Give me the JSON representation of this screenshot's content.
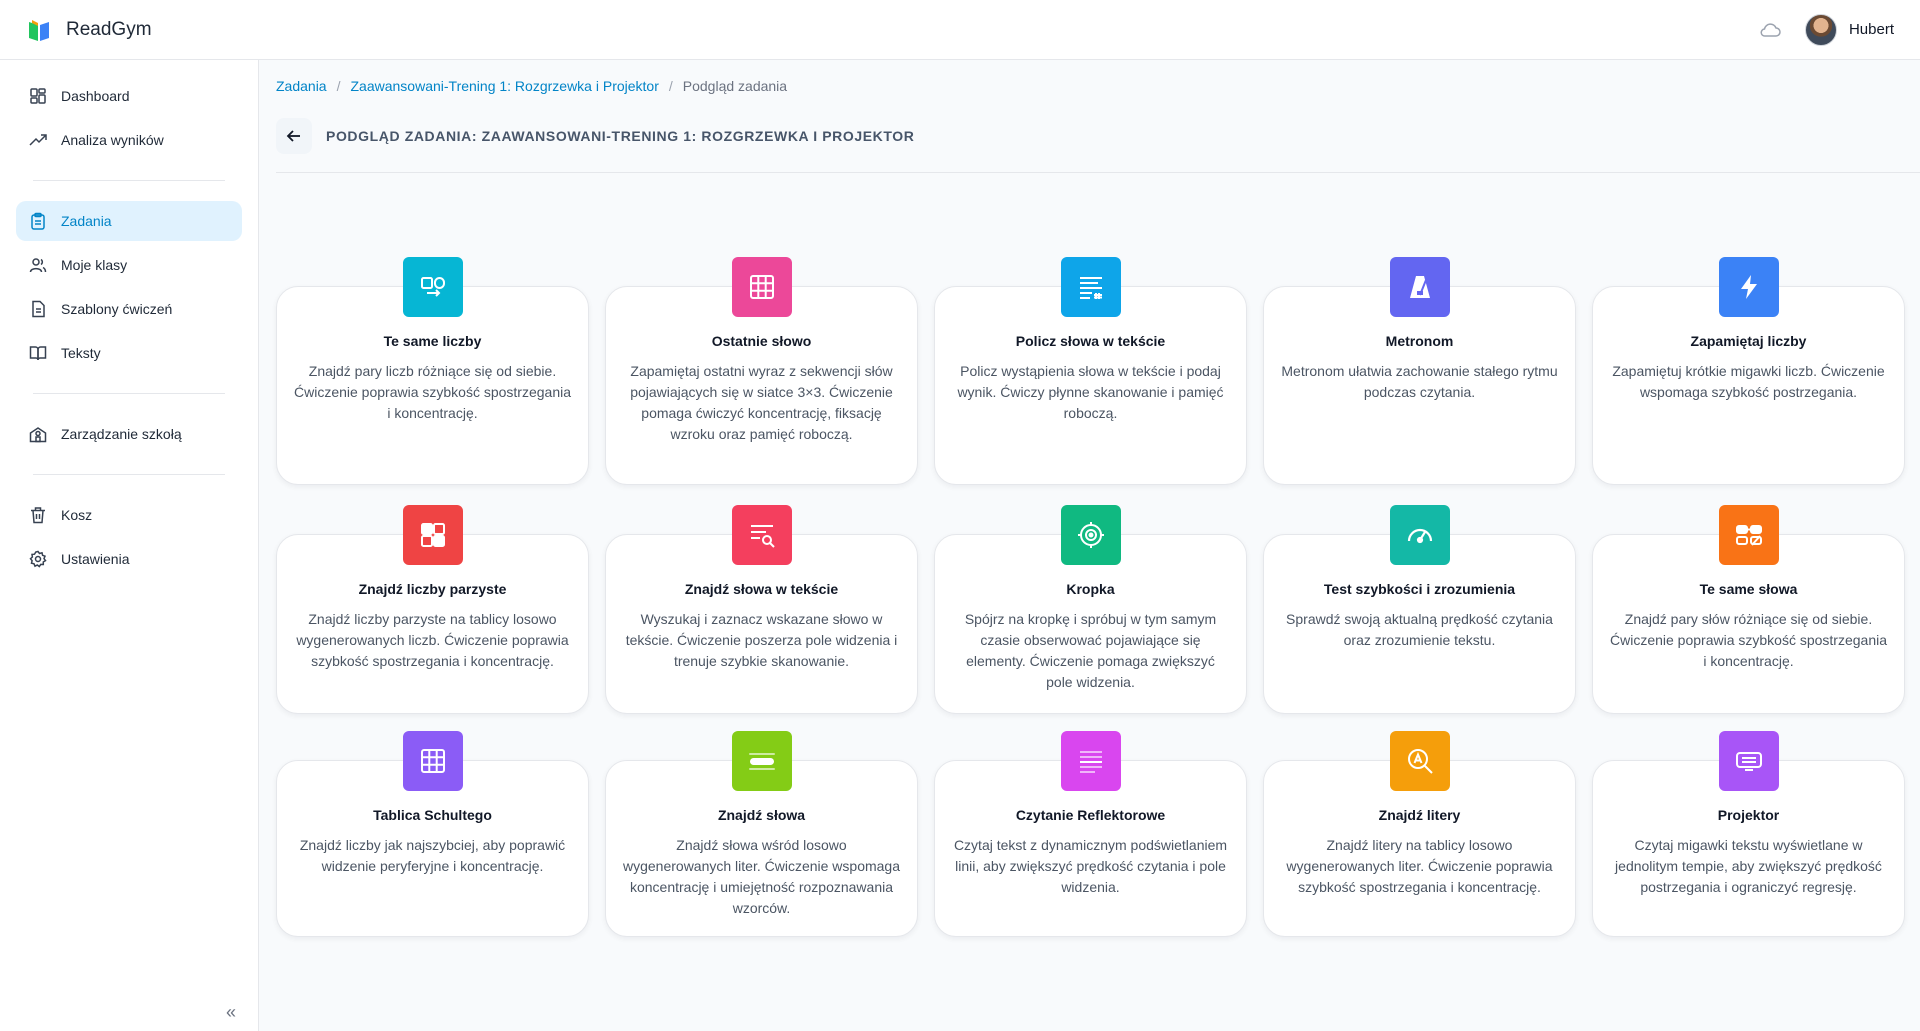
{
  "app": {
    "name": "ReadGym"
  },
  "user": {
    "name": "Hubert"
  },
  "sidebar": {
    "items": [
      {
        "label": "Dashboard"
      },
      {
        "label": "Analiza wyników"
      },
      {
        "label": "Zadania"
      },
      {
        "label": "Moje klasy"
      },
      {
        "label": "Szablony ćwiczeń"
      },
      {
        "label": "Teksty"
      },
      {
        "label": "Zarządzanie szkołą"
      },
      {
        "label": "Kosz"
      },
      {
        "label": "Ustawienia"
      }
    ],
    "collapse": "«"
  },
  "breadcrumb": {
    "root": "Zadania",
    "parent": "Zaawansowani-Trening 1: Rozgrzewka i Projektor",
    "current": "Podgląd zadania",
    "sep": "/"
  },
  "page": {
    "title": "PODGLĄD ZADANIA: ZAAWANSOWANI-TRENING 1: ROZGRZEWKA I PROJEKTOR"
  },
  "cards": [
    {
      "title": "Te same liczby",
      "desc": "Znajdź pary liczb różniące się od siebie. Ćwiczenie poprawia szybkość spostrzegania i koncentrację.",
      "color": "#06b6d4",
      "icon": "compare-icon"
    },
    {
      "title": "Ostatnie słowo",
      "desc": "Zapamiętaj ostatni wyraz z sekwencji słów pojawiających się w siatce 3×3. Ćwiczenie pomaga ćwiczyć koncentrację, fiksację wzroku oraz pamięć roboczą.",
      "color": "#ec4899",
      "icon": "grid-icon"
    },
    {
      "title": "Policz słowa w tekście",
      "desc": "Policz wystąpienia słowa w tekście i podaj wynik. Ćwiczy płynne skanowanie i pamięć roboczą.",
      "color": "#0ea5e9",
      "icon": "text-lines-icon"
    },
    {
      "title": "Metronom",
      "desc": "Metronom ułatwia zachowanie stałego rytmu podczas czytania.",
      "color": "#6366f1",
      "icon": "metronome-icon"
    },
    {
      "title": "Zapamiętaj liczby",
      "desc": "Zapamiętuj krótkie migawki liczb. Ćwiczenie wspomaga szybkość postrzegania.",
      "color": "#3b82f6",
      "icon": "lightning-icon"
    },
    {
      "title": "Znajdź liczby parzyste",
      "desc": "Znajdź liczby parzyste na tablicy losowo wygenerowanych liczb. Ćwiczenie poprawia szybkość spostrzegania i koncentrację.",
      "color": "#ef4444",
      "icon": "tiles-icon"
    },
    {
      "title": "Znajdź słowa w tekście",
      "desc": "Wyszukaj i zaznacz wskazane słowo w tekście. Ćwiczenie poszerza pole widzenia i trenuje szybkie skanowanie.",
      "color": "#f43f5e",
      "icon": "search-text-icon"
    },
    {
      "title": "Kropka",
      "desc": "Spójrz na kropkę i spróbuj w tym samym czasie obserwować pojawiające się elementy. Ćwiczenie pomaga zwiększyć pole widzenia.",
      "color": "#10b981",
      "icon": "target-icon"
    },
    {
      "title": "Test szybkości i zrozumienia",
      "desc": "Sprawdź swoją aktualną prędkość czytania oraz zrozumienie tekstu.",
      "color": "#14b8a6",
      "icon": "gauge-icon"
    },
    {
      "title": "Te same słowa",
      "desc": "Znajdź pary słów różniące się od siebie. Ćwiczenie poprawia szybkość spostrzegania i koncentrację.",
      "color": "#f97316",
      "icon": "word-pairs-icon"
    },
    {
      "title": "Tablica Schultego",
      "desc": "Znajdź liczby jak najszybciej, aby poprawić widzenie peryferyjne i koncentrację.",
      "color": "#8b5cf6",
      "icon": "schulte-grid-icon"
    },
    {
      "title": "Znajdź słowa",
      "desc": "Znajdź słowa wśród losowo wygenerowanych liter. Ćwiczenie wspomaga koncentrację i umiejętność rozpoznawania wzorców.",
      "color": "#84cc16",
      "icon": "word-bar-icon"
    },
    {
      "title": "Czytanie Reflektorowe",
      "desc": "Czytaj tekst z dynamicznym podświetlaniem linii, aby zwiększyć prędkość czytania i pole widzenia.",
      "color": "#d946ef",
      "icon": "highlight-lines-icon"
    },
    {
      "title": "Znajdź litery",
      "desc": "Znajdź litery na tablicy losowo wygenerowanych liter. Ćwiczenie poprawia szybkość spostrzegania i koncentrację.",
      "color": "#f59e0b",
      "icon": "letter-search-icon"
    },
    {
      "title": "Projektor",
      "desc": "Czytaj migawki tekstu wyświetlane w jednolitym tempie, aby zwiększyć prędkość postrzegania i ograniczyć regresję.",
      "color": "#a855f7",
      "icon": "projector-icon"
    }
  ]
}
